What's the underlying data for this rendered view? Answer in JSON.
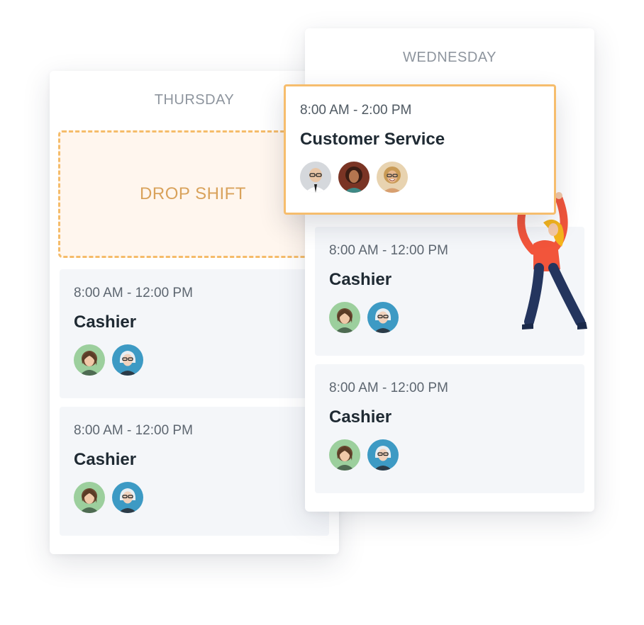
{
  "thursday": {
    "header": "THURSDAY",
    "drop_zone_label": "DROP SHIFT",
    "shifts": [
      {
        "time": "8:00 AM - 12:00 PM",
        "role": "Cashier",
        "avatars": [
          "avatar-woman-green-icon",
          "avatar-woman-blue-icon"
        ]
      },
      {
        "time": "8:00 AM - 12:00 PM",
        "role": "Cashier",
        "avatars": [
          "avatar-woman-green-icon",
          "avatar-woman-blue-icon"
        ]
      }
    ]
  },
  "wednesday": {
    "header": "WEDNESDAY",
    "dragged_shift": {
      "time": "8:00 AM - 2:00 PM",
      "role": "Customer Service",
      "avatars": [
        "avatar-man-glasses-icon",
        "avatar-woman-dark-icon",
        "avatar-woman-laughing-icon"
      ]
    },
    "shifts": [
      {
        "time": "8:00 AM - 12:00 PM",
        "role": "Cashier",
        "avatars": [
          "avatar-woman-green-icon",
          "avatar-woman-blue-icon"
        ]
      },
      {
        "time": "8:00 AM - 12:00 PM",
        "role": "Cashier",
        "avatars": [
          "avatar-woman-green-icon",
          "avatar-woman-blue-icon"
        ]
      }
    ]
  },
  "colors": {
    "accent_orange": "#f6bd6d",
    "drop_zone_bg": "#fff6ee",
    "drop_label": "#d9a25b",
    "card_bg": "#f4f6f9",
    "header_gray": "#8e959e",
    "figure_shirt": "#f2553b",
    "figure_pants": "#24355e"
  }
}
